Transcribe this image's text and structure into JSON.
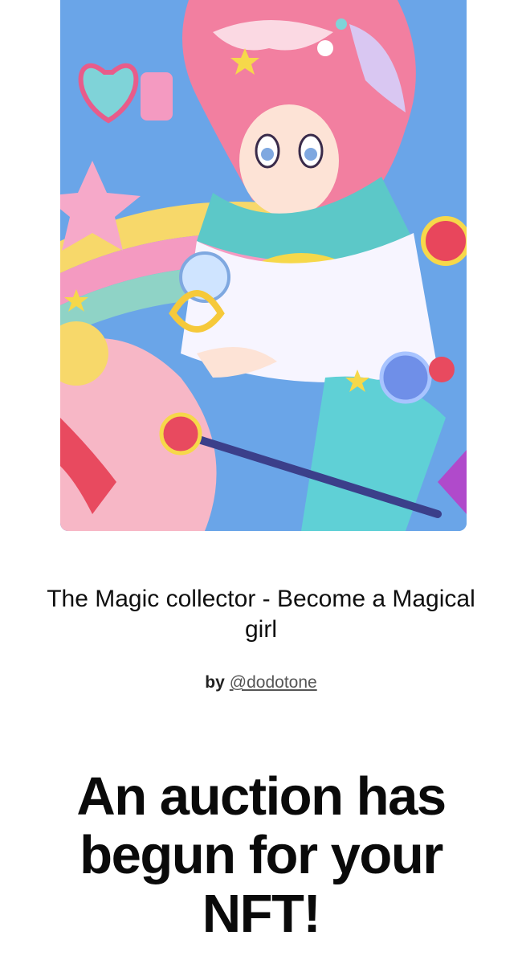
{
  "nft": {
    "title": "The Magic collector - Become a Magical girl",
    "by_label": "by",
    "creator_handle": "@dodotone"
  },
  "notification": {
    "headline": "An auction has begun for your NFT!"
  },
  "colors": {
    "art_sky": "#6aa5e8",
    "art_pink": "#f49ac1",
    "art_hair": "#f27fa0",
    "art_yellow": "#f6d84a",
    "art_teal": "#5cc8c8"
  }
}
